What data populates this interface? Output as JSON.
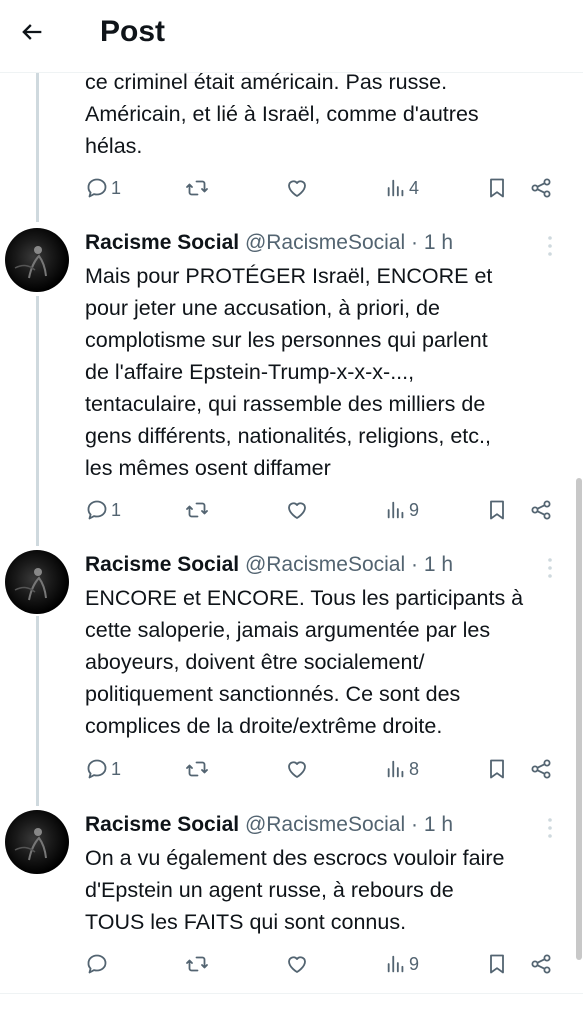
{
  "header": {
    "title": "Post"
  },
  "top_post": {
    "lines": [
      "ce criminel était américain. Pas russe.",
      "Américain, et lié à Israël, comme d'autres",
      "hélas."
    ],
    "replies": "1",
    "views": "4"
  },
  "posts": [
    {
      "name": "Racisme Social",
      "handle": "@RacismeSocial",
      "dot": "·",
      "time": "1 h",
      "lines": [
        "Mais pour PROTÉGER Israël, ENCORE et",
        "pour jeter une accusation, à priori, de",
        "complotisme sur les personnes qui parlent",
        "de l'affaire Epstein-Trump-x-x-x-...,",
        "tentaculaire, qui rassemble des milliers de",
        "gens différents, nationalités, religions, etc.,",
        "les mêmes osent diffamer"
      ],
      "replies": "1",
      "views": "9"
    },
    {
      "name": "Racisme Social",
      "handle": "@RacismeSocial",
      "dot": "·",
      "time": "1 h",
      "lines": [
        "ENCORE et ENCORE. Tous les participants à",
        "cette saloperie, jamais argumentée par les",
        "aboyeurs, doivent être socialement/",
        "politiquement sanctionnés. Ce sont des",
        "complices de la droite/extrême droite."
      ],
      "replies": "1",
      "views": "8"
    },
    {
      "name": "Racisme Social",
      "handle": "@RacismeSocial",
      "dot": "·",
      "time": "1 h",
      "lines": [
        "On a vu également des escrocs vouloir faire",
        "d'Epstein un agent russe, à rebours de",
        "TOUS les FAITS qui sont connus."
      ],
      "replies": "",
      "views": "9"
    }
  ]
}
